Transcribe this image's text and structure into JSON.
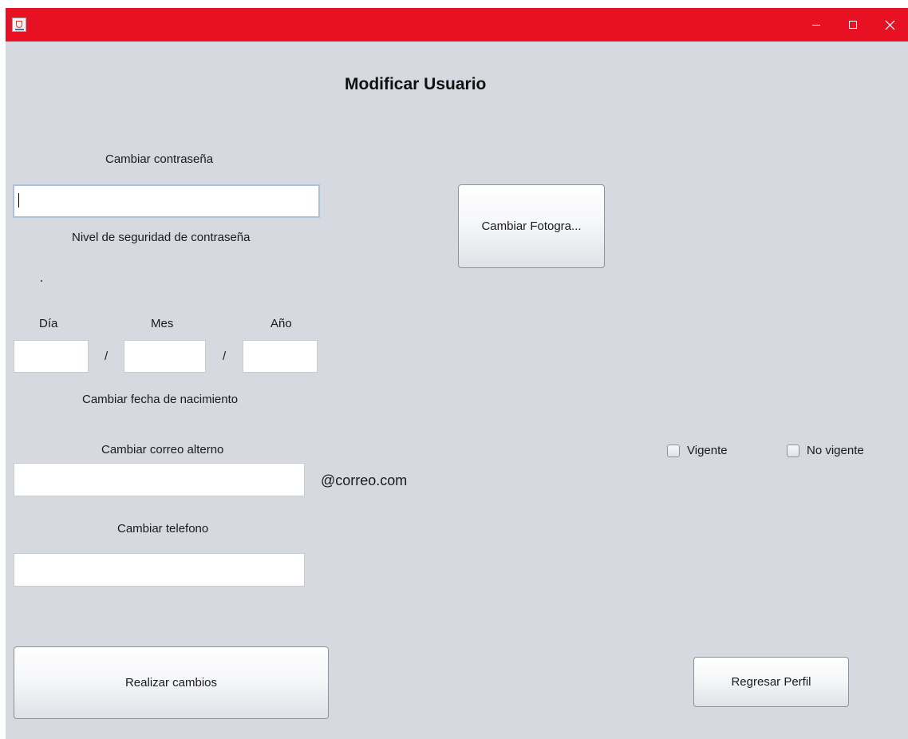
{
  "window": {
    "titlebar_color": "#e81123",
    "icons": [
      "java-app-icon",
      "minimize-icon",
      "maximize-icon",
      "close-icon"
    ]
  },
  "form": {
    "title": "Modificar Usuario",
    "password_label": "Cambiar contraseña",
    "password_value": "",
    "security_level_label": "Nivel de seguridad de contraseña",
    "security_level_value": ".",
    "dia_label": "Día",
    "mes_label": "Mes",
    "anio_label": "Año",
    "date_separator": "/",
    "dia_value": "",
    "mes_value": "",
    "anio_value": "",
    "birthdate_label": "Cambiar fecha de nacimiento",
    "email_label": "Cambiar correo alterno",
    "email_value": "",
    "email_suffix": "@correo.com",
    "phone_label": "Cambiar telefono",
    "phone_value": ""
  },
  "buttons": {
    "change_photo": "Cambiar Fotogra...",
    "apply_changes": "Realizar cambios",
    "back_to_profile": "Regresar Perfil"
  },
  "status": {
    "vigente_label": "Vigente",
    "vigente_checked": false,
    "no_vigente_label": "No vigente",
    "no_vigente_checked": false
  }
}
